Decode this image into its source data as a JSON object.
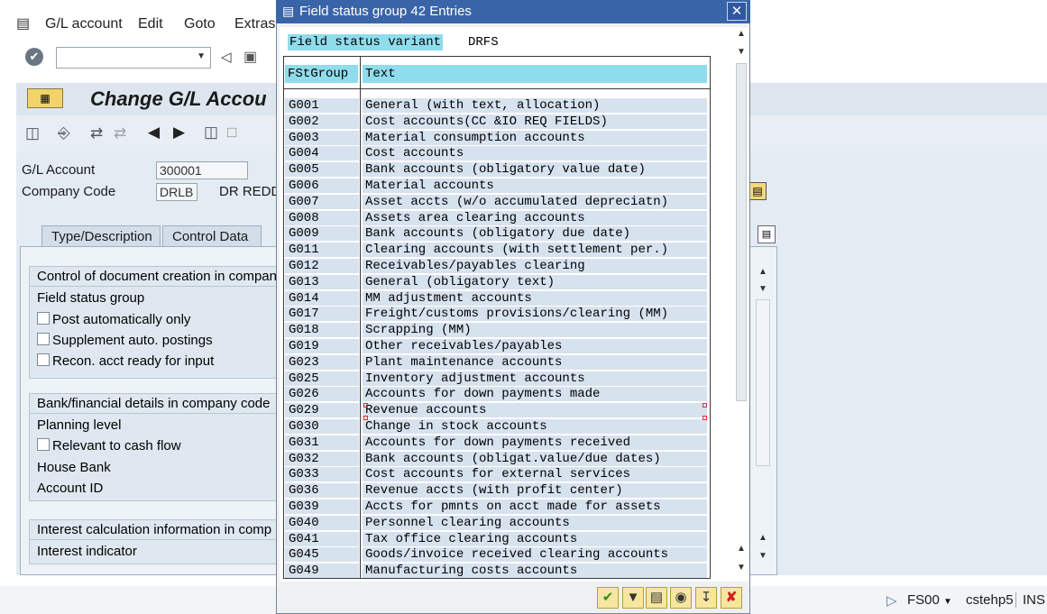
{
  "main": {
    "menu": [
      "G/L account",
      "Edit",
      "Goto",
      "Extras"
    ],
    "page_title": "Change G/L Accou",
    "gl_account_label": "G/L Account",
    "gl_account_value": "300001",
    "company_code_label": "Company Code",
    "company_code_value": "DRLB",
    "company_name": "DR REDD",
    "tabs": [
      "Type/Description",
      "Control Data"
    ],
    "groups": {
      "doc_creation": {
        "title": "Control of document creation in compan",
        "field_status_group": "Field status group",
        "post_automatically": "Post automatically only",
        "supplement_auto": "Supplement auto. postings",
        "recon_acct": "Recon. acct ready for input"
      },
      "bank": {
        "title": "Bank/financial details in company code",
        "planning_level": "Planning level",
        "relevant_cash_flow": "Relevant to cash flow",
        "house_bank": "House Bank",
        "account_id": "Account ID"
      },
      "interest": {
        "title": "Interest calculation information in comp",
        "interest_indicator": "Interest indicator"
      }
    },
    "statusbar": {
      "tcode": "FS00",
      "server": "cstehp5",
      "mode": "INS"
    }
  },
  "popup": {
    "title": "Field status group 42 Entries",
    "variant_label": "Field status variant",
    "variant_value": "DRFS",
    "columns": [
      "FStGroup",
      "Text"
    ],
    "rows": [
      [
        "G001",
        "General (with text, allocation)"
      ],
      [
        "G002",
        "Cost accounts(CC &IO REQ FIELDS)"
      ],
      [
        "G003",
        "Material consumption accounts"
      ],
      [
        "G004",
        "Cost accounts"
      ],
      [
        "G005",
        "Bank accounts (obligatory value date)"
      ],
      [
        "G006",
        "Material accounts"
      ],
      [
        "G007",
        "Asset accts (w/o accumulated depreciatn)"
      ],
      [
        "G008",
        "Assets area clearing accounts"
      ],
      [
        "G009",
        "Bank accounts (obligatory due date)"
      ],
      [
        "G011",
        "Clearing accounts (with settlement per.)"
      ],
      [
        "G012",
        "Receivables/payables clearing"
      ],
      [
        "G013",
        "General (obligatory text)"
      ],
      [
        "G014",
        "MM adjustment accounts"
      ],
      [
        "G017",
        "Freight/customs provisions/clearing (MM)"
      ],
      [
        "G018",
        "Scrapping (MM)"
      ],
      [
        "G019",
        "Other receivables/payables"
      ],
      [
        "G023",
        "Plant maintenance accounts"
      ],
      [
        "G025",
        "Inventory adjustment accounts"
      ],
      [
        "G026",
        "Accounts for down payments made"
      ],
      [
        "G029",
        "Revenue accounts"
      ],
      [
        "G030",
        "Change in stock accounts"
      ],
      [
        "G031",
        "Accounts for down payments received"
      ],
      [
        "G032",
        "Bank accounts (obligat.value/due dates)"
      ],
      [
        "G033",
        "Cost accounts for external services"
      ],
      [
        "G036",
        "Revenue accts (with profit center)"
      ],
      [
        "G039",
        "Accts for pmnts on acct made for assets"
      ],
      [
        "G040",
        "Personnel clearing accounts"
      ],
      [
        "G041",
        "Tax office clearing accounts"
      ],
      [
        "G045",
        "Goods/invoice received clearing accounts"
      ],
      [
        "G049",
        "Manufacturing costs accounts"
      ]
    ],
    "footer_buttons": [
      "check-icon",
      "filter-icon",
      "find-icon",
      "binoculars-icon",
      "sort-icon",
      "cancel-icon"
    ]
  }
}
